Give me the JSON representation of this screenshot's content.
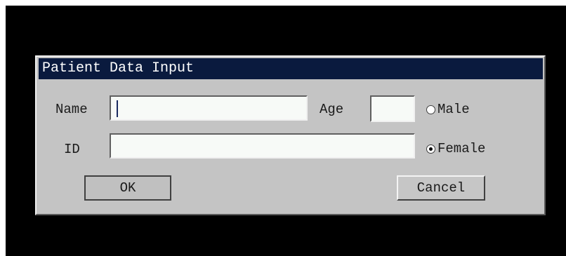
{
  "dialog": {
    "title": "Patient Data Input",
    "fields": {
      "name_label": "Name",
      "name_value": "",
      "age_label": "Age",
      "age_value": "",
      "id_label": "ID",
      "id_value": ""
    },
    "sex": {
      "options": [
        "Male",
        "Female"
      ],
      "selected": "Female"
    },
    "buttons": {
      "ok_label": "OK",
      "cancel_label": "Cancel"
    }
  },
  "colors": {
    "screen_background": "#000000",
    "dialog_background": "#c4c4c4",
    "titlebar_background": "#0a1a3e",
    "titlebar_text": "#ffffff",
    "field_background": "#f7faf7"
  }
}
